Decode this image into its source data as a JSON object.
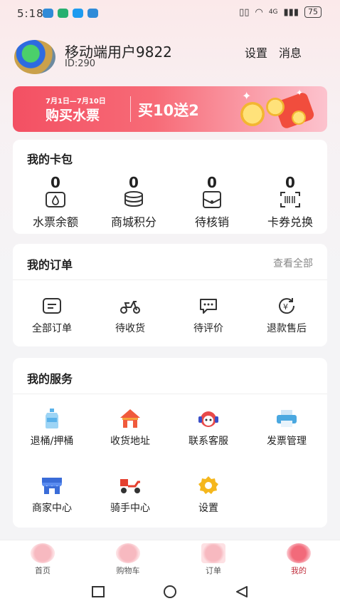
{
  "status": {
    "time": "5:18",
    "network": "4G",
    "battery": "75"
  },
  "header": {
    "username": "移动端用户9822",
    "user_id": "ID:290",
    "settings": "设置",
    "messages": "消息"
  },
  "banner": {
    "date": "7月1日—7月10日",
    "title": "购买水票",
    "promo": "买10送2"
  },
  "wallet": {
    "title": "我的卡包",
    "items": [
      {
        "value": "0",
        "label": "水票余额",
        "icon": "water-ticket-icon"
      },
      {
        "value": "0",
        "label": "商城积分",
        "icon": "coin-stack-icon"
      },
      {
        "value": "0",
        "label": "待核销",
        "icon": "pending-verify-icon"
      },
      {
        "value": "0",
        "label": "卡券兑换",
        "icon": "barcode-scan-icon"
      }
    ]
  },
  "orders": {
    "title": "我的订单",
    "view_all": "查看全部",
    "items": [
      {
        "label": "全部订单",
        "icon": "order-list-icon"
      },
      {
        "label": "待收货",
        "icon": "scooter-icon"
      },
      {
        "label": "待评价",
        "icon": "comment-icon"
      },
      {
        "label": "退款售后",
        "icon": "refund-icon"
      }
    ]
  },
  "services": {
    "title": "我的服务",
    "items": [
      {
        "label": "退桶/押桶",
        "icon": "water-bucket-icon"
      },
      {
        "label": "收货地址",
        "icon": "house-icon"
      },
      {
        "label": "联系客服",
        "icon": "customer-service-icon"
      },
      {
        "label": "发票管理",
        "icon": "printer-icon"
      },
      {
        "label": "商家中心",
        "icon": "shop-icon"
      },
      {
        "label": "骑手中心",
        "icon": "delivery-bike-icon"
      },
      {
        "label": "设置",
        "icon": "gear-icon"
      }
    ]
  },
  "tabbar": {
    "items": [
      {
        "label": "首页",
        "icon": "home-icon"
      },
      {
        "label": "购物车",
        "icon": "cart-icon"
      },
      {
        "label": "订单",
        "icon": "orders-icon"
      },
      {
        "label": "我的",
        "icon": "profile-icon"
      }
    ],
    "active": "我的"
  },
  "colors": {
    "accent": "#f35063",
    "active_tab": "#c0303e"
  }
}
